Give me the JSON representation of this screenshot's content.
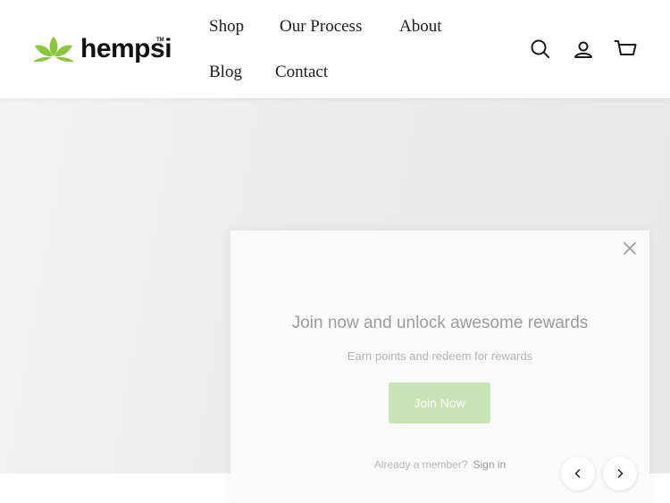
{
  "header": {
    "logo_text": "hempsi",
    "logo_tm": "TM",
    "nav": [
      {
        "label": "Shop"
      },
      {
        "label": "Our Process"
      },
      {
        "label": "About"
      },
      {
        "label": "Blog"
      },
      {
        "label": "Contact"
      }
    ],
    "icons": [
      "search-icon",
      "account-icon",
      "cart-icon"
    ]
  },
  "popup": {
    "title": "Join now and unlock awesome rewards",
    "subtitle": "Earn points and redeem for rewards",
    "join_label": "Join Now",
    "member_text": "Already a member?",
    "sign_in_label": "Sign in"
  },
  "carousel": {
    "icons": [
      "chevron-left-icon",
      "chevron-right-icon"
    ]
  },
  "colors": {
    "brand_green": "#8cc63f",
    "join_button": "#c9e3b4",
    "text_dark": "#1d1d1d"
  }
}
